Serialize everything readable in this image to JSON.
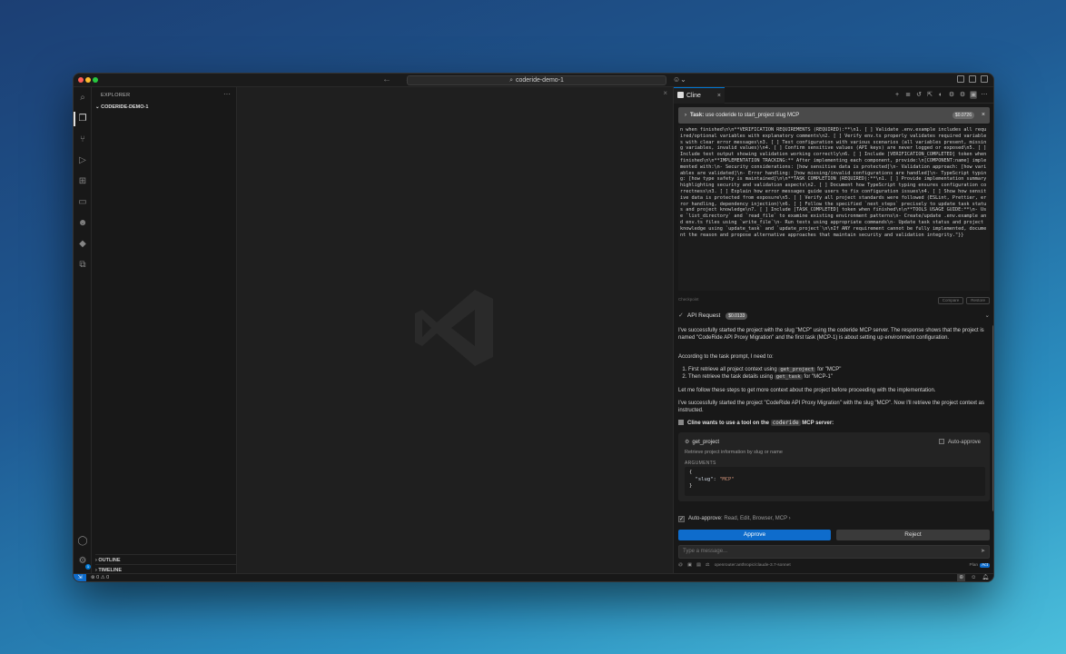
{
  "titlebar": {
    "search_text": "coderide-demo-1",
    "nav_arrows": "← →",
    "copilot_glyph": "☺⌄"
  },
  "activity_bar": {
    "icons": [
      "search-icon",
      "explorer-icon",
      "source-control-icon",
      "run-debug-icon",
      "extensions-icon",
      "remote-explorer-icon",
      "cline-icon",
      "docker-icon",
      "containers-icon",
      "account-icon",
      "settings-icon"
    ],
    "settings_badge": "1"
  },
  "explorer": {
    "title": "EXPLORER",
    "more": "···",
    "folder": "CODERIDE-DEMO-1",
    "outline": "OUTLINE",
    "timeline": "TIMELINE"
  },
  "cline": {
    "tab_label": "Cline",
    "tab_close": "×",
    "task": {
      "label": "Task:",
      "text": "use coderide to start_project slug MCP",
      "cost": "$0.0726"
    },
    "code_output": "n when finished\\n\\n**VERIFICATION REQUIREMENTS (REQUIRED):**\\n1. [ ] Validate .env.example includes all required/optional variables with explanatory comments\\n2. [ ] Verify env.ts properly validates required variables with clear error messages\\n3. [ ] Test configuration with various scenarios (all variables present, missing variables, invalid values)\\n4. [ ] Confirm sensitive values (API keys) are never logged or exposed\\n5. [ ] Include test output showing validation working correctly\\n6. [ ] Include [VERIFICATION_COMPLETED] token when finished\\n\\n**IMPLEMENTATION TRACKING:** After implementing each component, provide:\\n[COMPONENT:name] implemented with:\\n- Security considerations: [how sensitive data is protected]\\n- Validation approach: [how variables are validated]\\n- Error handling: [how missing/invalid configurations are handled]\\n- TypeScript typing: [how type safety is maintained]\\n\\n**TASK COMPLETION (REQUIRED):**\\n1. [ ] Provide implementation summary highlighting security and validation aspects\\n2. [ ] Document how TypeScript typing ensures configuration correctness\\n3. [ ] Explain how error messages guide users to fix configuration issues\\n4. [ ] Show how sensitive data is protected from exposure\\n5. [ ] Verify all project standards were followed (ESLint, Prettier, error handling, dependency injection)\\n6. [ ] Follow the specified `next_steps` precisely to update task status and project knowledge\\n7. [ ] Include [TASK_COMPLETED] token when finished\\n\\n**TOOLS USAGE GUIDE:**\\n- Use `list_directory` and `read_file` to examine existing environment patterns\\n- Create/update .env.example and env.ts files using `write_file`\\n- Run tests using appropriate commands\\n- Update task status and project knowledge using `update_task` and `update_project`\\n\\nIf ANY requirement cannot be fully implemented, document the reason and propose alternative approaches that maintain security and validation integrity.\"}}",
    "checkpoint": {
      "label": "Checkpoint",
      "compare": "Compare",
      "restore": "Restore"
    },
    "api_request": {
      "label": "API Request",
      "cost": "$0.0133"
    },
    "messages": {
      "p1": "I've successfully started the project with the slug \"MCP\" using the coderide MCP server. The response shows that the project is named \"CodeRide API Proxy Migration\" and the first task (MCP-1) is about setting up environment configuration.",
      "p2": "According to the task prompt, I need to:",
      "li1_pre": "First retrieve all project context using ",
      "li1_code": "get_project",
      "li1_post": " for \"MCP\"",
      "li2_pre": "Then retrieve the task details using ",
      "li2_code": "get_task",
      "li2_post": " for \"MCP-1\"",
      "p3": "Let me follow these steps to get more context about the project before proceeding with the implementation.",
      "p4": "I've successfully started the project \"CodeRide API Proxy Migration\" with the slug \"MCP\". Now I'll retrieve the project context as instructed."
    },
    "tool_request": {
      "title_pre": "Cline wants to use a tool on the ",
      "server": "coderide",
      "title_post": " MCP server:",
      "tool_name": "get_project",
      "auto_approve": "Auto-approve",
      "description": "Retrieve project information by slug or name",
      "arguments_label": "ARGUMENTS",
      "args_open": "{",
      "args_key": "\"slug\"",
      "args_sep": ": ",
      "args_value": "\"MCP\"",
      "args_close": "}"
    },
    "auto_approve_row": {
      "label": "Auto-approve:",
      "items": "Read, Edit, Browser, MCP",
      "chevron": "›"
    },
    "approve_label": "Approve",
    "reject_label": "Reject",
    "input_placeholder": "Type a message...",
    "model": "openrouter:anthropic/claude-3.7-sonnet",
    "mode_plan": "Plan",
    "mode_act": "Act"
  },
  "statusbar": {
    "problems": "⊗ 0 ⚠ 0"
  }
}
